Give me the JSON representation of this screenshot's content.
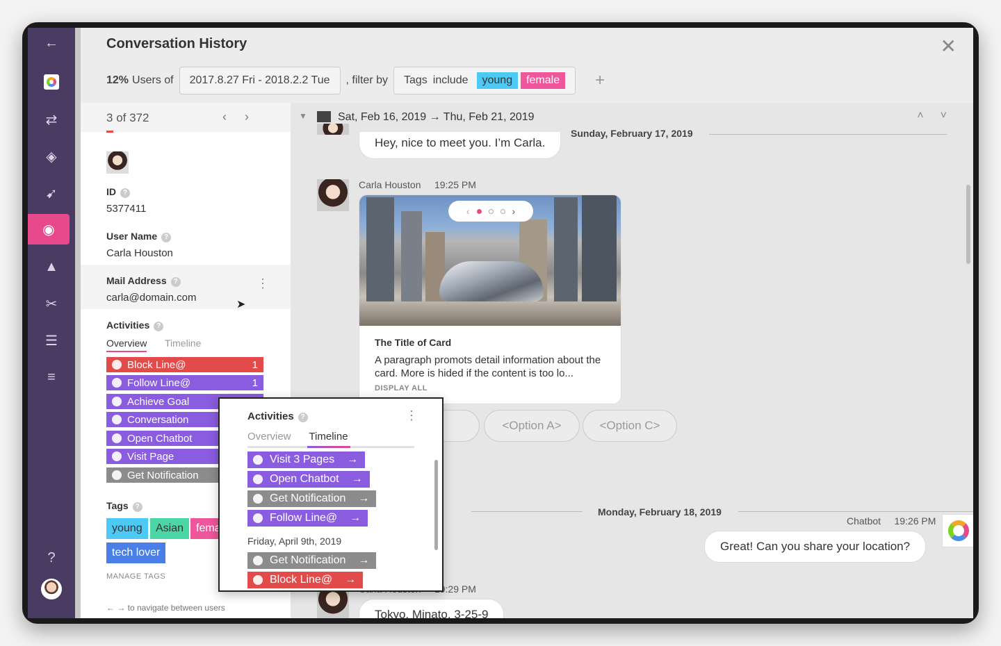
{
  "colors": {
    "nav_bg": "#4a3b63",
    "accent_pink": "#e8488c",
    "purple": "#8a5ce0",
    "red": "#e34b4b",
    "gray": "#8c8c8c",
    "tag_young": "#4dc9f6",
    "tag_female": "#f0569b",
    "tag_asian": "#4cd6a5",
    "tag_tech": "#4a7fe8"
  },
  "nav": {
    "back_icon": "arrow-left-icon",
    "items": [
      "logo-icon",
      "flow-icon",
      "layers-icon",
      "rocket-icon",
      "user-icon",
      "shapes-icon",
      "tools-icon",
      "server-icon",
      "sliders-icon"
    ],
    "help_icon": "question-circle-icon"
  },
  "header": {
    "title": "Conversation History",
    "percent": "12%",
    "users_of": "Users of",
    "date_range": "2017.8.27 Fri - 2018.2.2 Tue",
    "filter_by": ", filter by",
    "tags_label": "Tags",
    "include_label": "include",
    "tag1": "young",
    "tag2": "female",
    "plus": "+",
    "close": "✕"
  },
  "user": {
    "pager_current": "3",
    "pager_of": "of 372",
    "id_label": "ID",
    "id_value": "5377411",
    "username_label": "User Name",
    "username_value": "Carla Houston",
    "mail_label": "Mail Address",
    "mail_value": "carla@domain.com",
    "activities_label": "Activities",
    "tab_overview": "Overview",
    "tab_timeline": "Timeline",
    "activities": [
      {
        "label": "Block Line@",
        "count": "1"
      },
      {
        "label": "Follow Line@",
        "count": "1"
      },
      {
        "label": "Achieve Goal",
        "count": ""
      },
      {
        "label": "Conversation",
        "count": ""
      },
      {
        "label": "Open Chatbot",
        "count": ""
      },
      {
        "label": "Visit Page",
        "count": ""
      },
      {
        "label": "Get Notification",
        "count": ""
      }
    ],
    "tags_label": "Tags",
    "tags": [
      "young",
      "Asian",
      "female",
      "tech lover"
    ],
    "manage_tags": "MANAGE TAGS",
    "nav_hint": "← → to navigate between users"
  },
  "chat": {
    "range": "Sat, Feb 16, 2019 → Thu, Feb 21, 2019",
    "day1": "Sunday, February 17, 2019",
    "msg1": "Hey, nice to meet you. I’m Carla.",
    "sender1": "Carla Houston",
    "time1": "19:25 PM",
    "card_title": "The Title of Card",
    "card_body": "A paragraph promots detail information about the card. More is hided if the content is too lo...",
    "card_more": "DISPLAY ALL",
    "options": [
      "<Option A>",
      "<Option C>"
    ],
    "day2": "Monday, February 18, 2019",
    "bot_name": "Chatbot",
    "bot_time": "19:26 PM",
    "bot_msg": "Great! Can you share your location?",
    "sender3": "Carla Houston",
    "time3": "19:29 PM",
    "msg3": "Tokyo, Minato, 3-25-9"
  },
  "popover": {
    "title": "Activities",
    "tab_overview": "Overview",
    "tab_timeline": "Timeline",
    "items": [
      {
        "label": "Visit 3 Pages"
      },
      {
        "label": "Open Chatbot"
      },
      {
        "label": "Get Notification"
      },
      {
        "label": "Follow Line@"
      }
    ],
    "date": "Friday, April 9th, 2019",
    "items2": [
      {
        "label": "Get Notification"
      },
      {
        "label": "Block Line@"
      }
    ]
  }
}
